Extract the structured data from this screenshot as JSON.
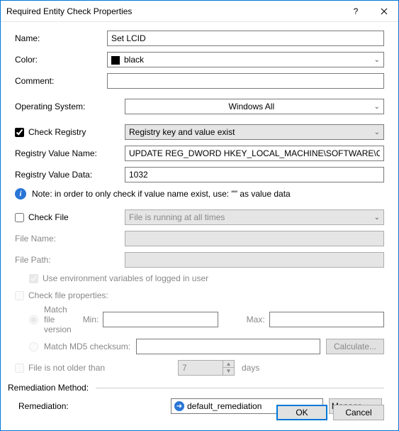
{
  "window": {
    "title": "Required Entity Check Properties"
  },
  "fields": {
    "name_label": "Name:",
    "name_value": "Set LCID",
    "color_label": "Color:",
    "color_value": "black",
    "comment_label": "Comment:",
    "comment_value": "",
    "os_label": "Operating System:",
    "os_value": "Windows All"
  },
  "registry": {
    "check_label": "Check Registry",
    "check_checked": true,
    "mode": "Registry key and value exist",
    "value_name_label": "Registry Value Name:",
    "value_name": "UPDATE REG_DWORD HKEY_LOCAL_MACHINE\\SOFTWARE\\CheckPo",
    "value_data_label": "Registry Value Data:",
    "value_data": "1032",
    "hint": "Note: in order to only check if value name exist, use: \"\" as  value data"
  },
  "file": {
    "check_label": "Check File",
    "check_checked": false,
    "mode": "File is running at all times",
    "name_label": "File Name:",
    "name_value": "",
    "path_label": "File Path:",
    "path_value": "",
    "env_vars_label": "Use environment variables of logged in user",
    "properties_label": "Check file properties:",
    "match_version_label": "Match  file version",
    "min_label": "Min:",
    "max_label": "Max:",
    "match_md5_label": "Match MD5 checksum:",
    "calculate_label": "Calculate...",
    "not_older_label": "File is not older than",
    "days_value": "7",
    "days_unit": "days"
  },
  "remediation": {
    "section_label": "Remediation Method:",
    "label": "Remediation:",
    "value": "default_remediation",
    "manage_label": "Manage..."
  },
  "buttons": {
    "ok": "OK",
    "cancel": "Cancel"
  }
}
